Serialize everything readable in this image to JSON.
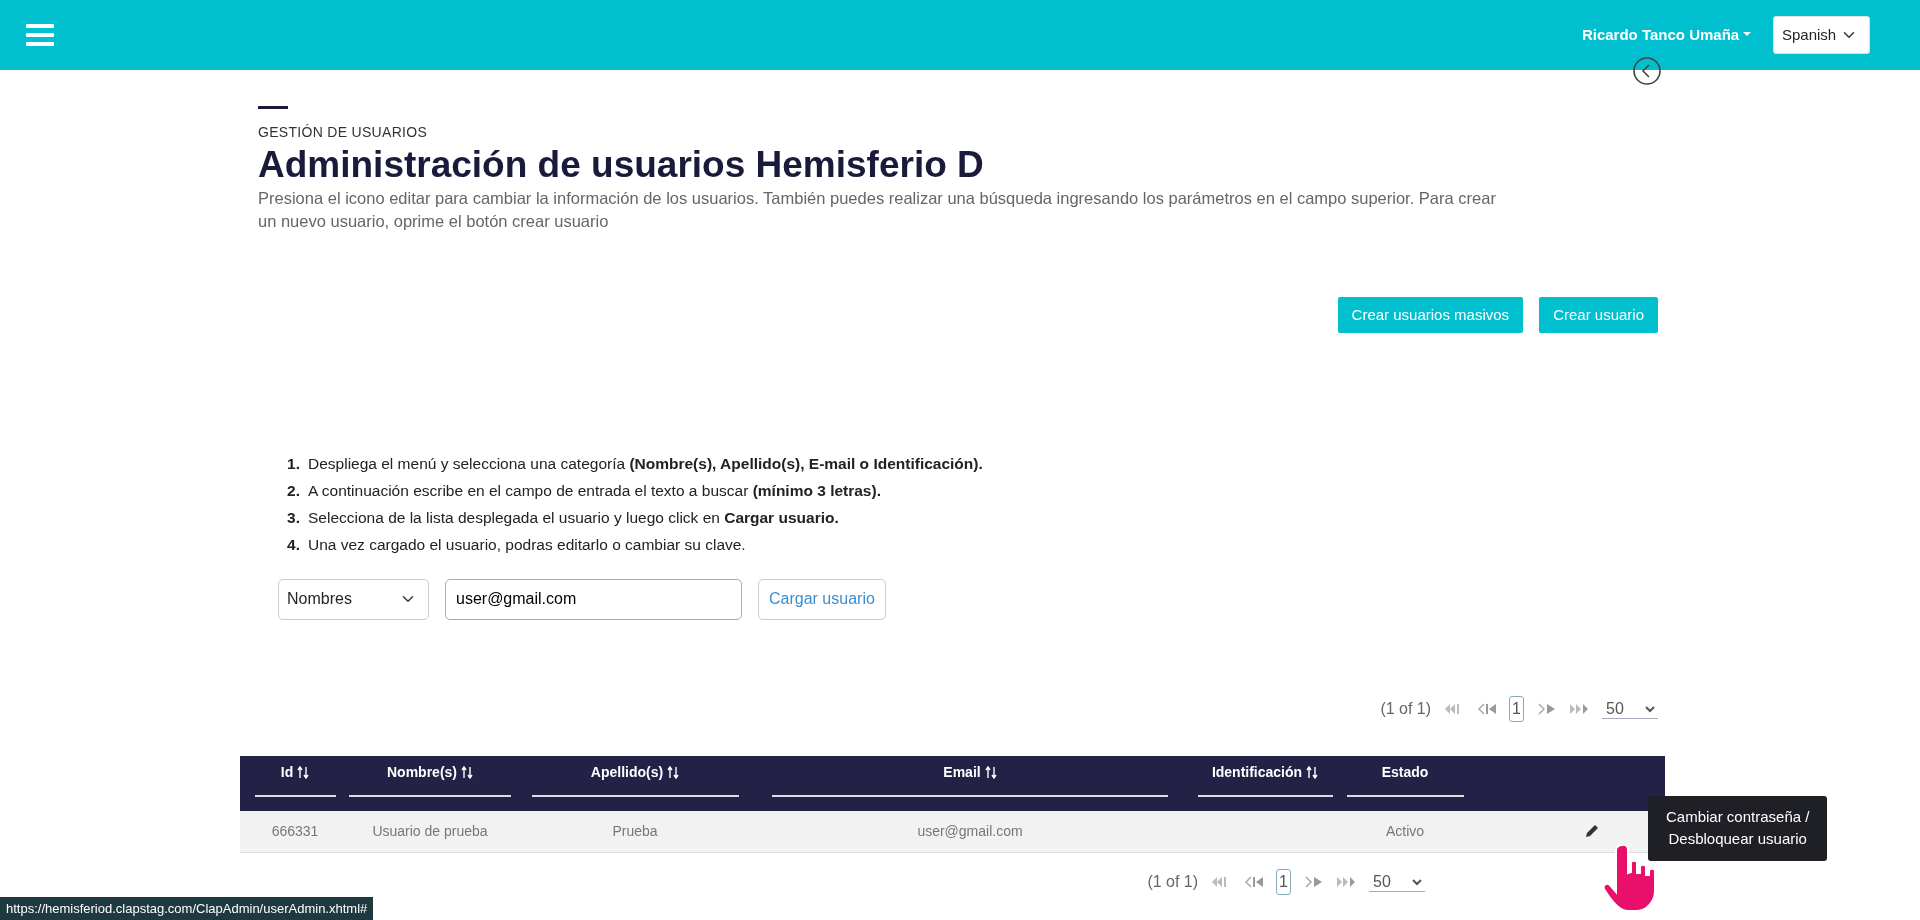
{
  "navbar": {
    "user": "Ricardo Tanco Umaña",
    "language": "Spanish"
  },
  "header": {
    "eyebrow": "GESTIÓN DE USUARIOS",
    "title": "Administración de usuarios Hemisferio D",
    "description": "Presiona el icono editar para cambiar la información de los usuarios. También puedes realizar una búsqueda ingresando los parámetros en el campo superior. Para crear un nuevo usuario, oprime el botón crear usuario"
  },
  "actions": [
    "Crear usuarios masivos",
    "Crear usuario"
  ],
  "instructions": [
    {
      "number": "1.",
      "text": "Despliega el menú y selecciona una categoría **(Nombre(s), Apellido(s), E-mail o Identificación).**"
    },
    {
      "number": "2.",
      "text": "A continuación escribe en el campo de entrada el texto a buscar **(mínimo 3 letras).**"
    },
    {
      "number": "3.",
      "text": "Selecciona de la lista desplegada el usuario y luego click en **Cargar usuario.**"
    },
    {
      "number": "4.",
      "text": "Una vez cargado el usuario, podras editarlo o cambiar su clave."
    }
  ],
  "search": {
    "category": "Nombres",
    "value": "user@gmail.com",
    "button": "Cargar usuario"
  },
  "pagination_top": {
    "summary": "(1 of 1)",
    "pages": [
      {
        "label": "1",
        "selected": true
      }
    ],
    "page_size": "50"
  },
  "table": {
    "columns": [
      {
        "label": "Id",
        "sortable": true
      },
      {
        "label": "Nombre(s)",
        "sortable": true
      },
      {
        "label": "Apellido(s)",
        "sortable": true
      },
      {
        "label": "Email",
        "sortable": true
      },
      {
        "label": "Identificación",
        "sortable": true
      },
      {
        "label": "Estado",
        "sortable": false
      }
    ],
    "rows": [
      {
        "cells": [
          "666331",
          "Usuario de prueba",
          "Prueba",
          "user@gmail.com",
          "",
          "Activo"
        ]
      }
    ]
  },
  "tooltip": {
    "lines": [
      "Cambiar contraseña /",
      "Desbloquear usuario"
    ]
  },
  "pagination_bottom": {
    "summary": "(1 of 1)",
    "pages": [
      {
        "label": "1",
        "selected": true
      }
    ],
    "page_size": "50"
  },
  "status_url": "https://hemisferiod.clapstag.com/ClapAdmin/userAdmin.xhtml#"
}
